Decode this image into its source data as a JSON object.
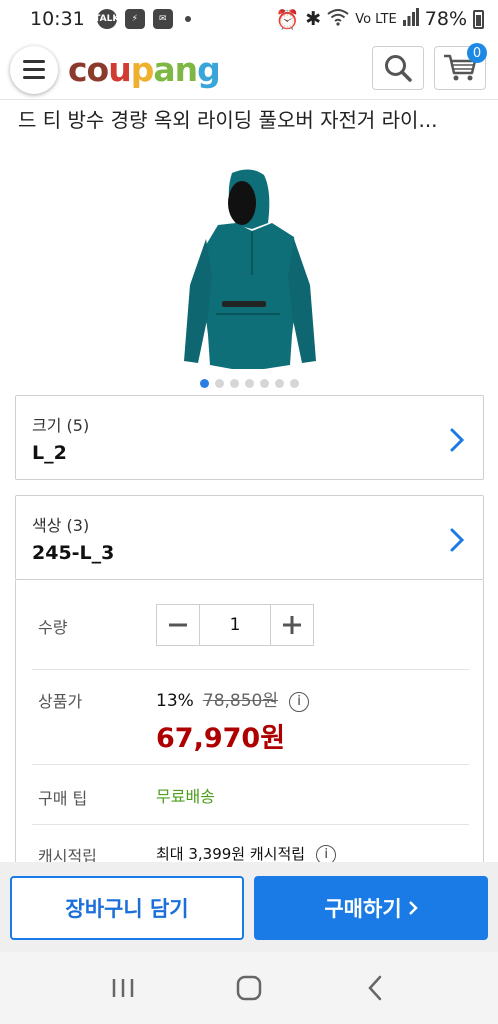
{
  "status_bar": {
    "time": "10:31",
    "battery": "78%",
    "net_label": "Vo LTE",
    "icons": [
      "talk-icon",
      "flash-icon",
      "mail-icon",
      "alarm-icon",
      "bluetooth-icon",
      "wifi-icon",
      "signal-icon",
      "battery-icon"
    ]
  },
  "header": {
    "logo_parts": [
      "co",
      "u",
      "p",
      "an",
      "g"
    ],
    "cart_count": "0",
    "brand_colors": [
      "#8a3b2c",
      "#d13c32",
      "#efb030",
      "#7fb744",
      "#3aa5d8"
    ]
  },
  "product": {
    "title": "드 티 방수 경량 옥외 라이딩 풀오버 자전거 라이...",
    "image_count": 7,
    "active_image": 0
  },
  "options": [
    {
      "label": "크기 (5)",
      "value": "L_2"
    },
    {
      "label": "색상 (3)",
      "value": "245-L_3"
    }
  ],
  "details": {
    "quantity_label": "수량",
    "quantity": "1",
    "price_label": "상품가",
    "discount": "13%",
    "original_price": "78,850원",
    "price": "67,970원",
    "tip_label": "구매 팁",
    "tip_value": "무료배송",
    "cash_label": "캐시적립",
    "cash_value": "최대 3,399원 캐시적립"
  },
  "actions": {
    "cart_label": "장바구니 담기",
    "buy_label": "구매하기"
  },
  "colors": {
    "accent": "#1a7be6",
    "price": "#ae0000",
    "tip": "#4d9e1d",
    "jacket": "#0f6f78"
  }
}
